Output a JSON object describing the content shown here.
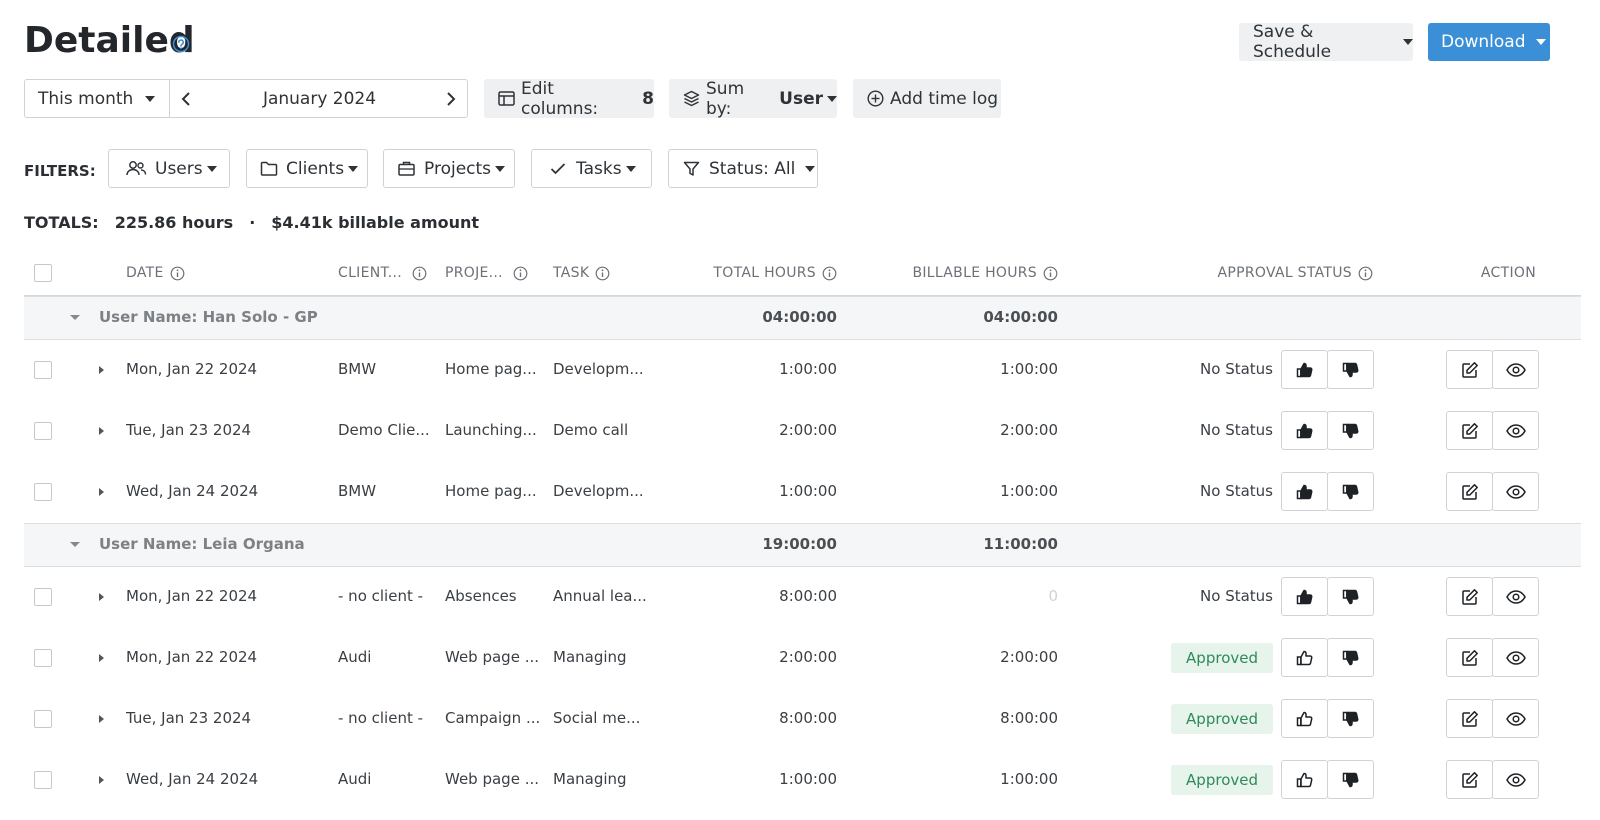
{
  "header": {
    "title": "Detailed",
    "save_schedule_label": "Save & Schedule",
    "download_label": "Download"
  },
  "toolbar": {
    "period_label": "This month",
    "month_label": "January 2024",
    "edit_columns_label": "Edit columns:",
    "edit_columns_count": "8",
    "sum_by_label": "Sum by:",
    "sum_by_value": "User",
    "add_time_log_label": "Add time log"
  },
  "filters": {
    "label": "FILTERS:",
    "users": "Users",
    "clients": "Clients",
    "projects": "Projects",
    "tasks": "Tasks",
    "status": "Status: All"
  },
  "totals": {
    "label": "TOTALS:",
    "hours": "225.86 hours",
    "separator": "·",
    "billable": "$4.41k billable amount"
  },
  "columns": {
    "date": "DATE",
    "client": "CLIENT...",
    "project": "PROJE...",
    "task": "TASK",
    "total_hours": "TOTAL HOURS",
    "billable_hours": "BILLABLE HOURS",
    "approval_status": "APPROVAL STATUS",
    "action": "ACTION"
  },
  "groups": [
    {
      "name": "User Name: Han Solo - GP",
      "total": "04:00:00",
      "billable": "04:00:00",
      "rows": [
        {
          "date": "Mon, Jan 22 2024",
          "client": "BMW",
          "project": "Home pag...",
          "task": "Developm...",
          "total": "1:00:00",
          "billable": "1:00:00",
          "status": "No Status"
        },
        {
          "date": "Tue, Jan 23 2024",
          "client": "Demo Clie...",
          "project": "Launching...",
          "task": "Demo call",
          "total": "2:00:00",
          "billable": "2:00:00",
          "status": "No Status"
        },
        {
          "date": "Wed, Jan 24 2024",
          "client": "BMW",
          "project": "Home pag...",
          "task": "Developm...",
          "total": "1:00:00",
          "billable": "1:00:00",
          "status": "No Status"
        }
      ]
    },
    {
      "name": "User Name: Leia Organa",
      "total": "19:00:00",
      "billable": "11:00:00",
      "rows": [
        {
          "date": "Mon, Jan 22 2024",
          "client": "- no client -",
          "project": "Absences",
          "task": "Annual lea...",
          "total": "8:00:00",
          "billable": "0",
          "status": "No Status"
        },
        {
          "date": "Mon, Jan 22 2024",
          "client": "Audi",
          "project": "Web page ...",
          "task": "Managing",
          "total": "2:00:00",
          "billable": "2:00:00",
          "status": "Approved"
        },
        {
          "date": "Tue, Jan 23 2024",
          "client": "- no client -",
          "project": "Campaign ...",
          "task": "Social me...",
          "total": "8:00:00",
          "billable": "8:00:00",
          "status": "Approved"
        },
        {
          "date": "Wed, Jan 24 2024",
          "client": "Audi",
          "project": "Web page ...",
          "task": "Managing",
          "total": "1:00:00",
          "billable": "1:00:00",
          "status": "Approved"
        }
      ]
    }
  ],
  "colors": {
    "primary": "#3a8fd6",
    "approved_bg": "#e6f4ec",
    "approved_text": "#2f8a57",
    "group_bg": "#f5f6f7"
  }
}
